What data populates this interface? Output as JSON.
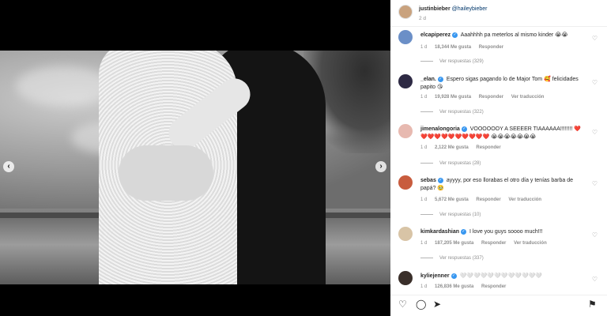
{
  "post": {
    "author": "justinbieber",
    "mention": "@haileybieber",
    "time": "2 d"
  },
  "carousel": {
    "prev_icon": "chevron-left-icon",
    "next_icon": "chevron-right-icon",
    "prev_glyph": "‹",
    "next_glyph": "›",
    "dots_count": 7,
    "active_dot": 5
  },
  "comments": [
    {
      "user": "elcapiperez",
      "text": "Aaahhhh pa meterlos al mismo kinder 😭😭",
      "time": "1 d",
      "likes": "18,344 Me gusta",
      "reply": "Responder",
      "translate": "",
      "replies": "Ver respuestas (329)",
      "avatar_color": "#6b8fc7"
    },
    {
      "user": "_elan.",
      "text": "Espero sigas pagando lo de Major Tom 🥰 felicidades papito 😘",
      "time": "1 d",
      "likes": "19,928 Me gusta",
      "reply": "Responder",
      "translate": "Ver traducción",
      "replies": "Ver respuestas (322)",
      "avatar_color": "#2e2a44"
    },
    {
      "user": "jimenalongoria",
      "text": "VOOOOOOY A SEEEER TIAAAAAA!!!!!!!! ❤️ ❤️❤️❤️❤️❤️❤️❤️❤️❤️❤️ 😭😭😭😭😭😭😭",
      "time": "1 d",
      "likes": "2,122 Me gusta",
      "reply": "Responder",
      "translate": "",
      "replies": "Ver respuestas (28)",
      "avatar_color": "#e7b9b0"
    },
    {
      "user": "sebas",
      "text": "ayyyy, por eso llorabas el otro día y tenías barba de papá? 🥹",
      "time": "1 d",
      "likes": "5,672 Me gusta",
      "reply": "Responder",
      "translate": "Ver traducción",
      "replies": "Ver respuestas (10)",
      "avatar_color": "#c85c3e"
    },
    {
      "user": "kimkardashian",
      "text": "I love you guys soooo much!!!",
      "time": "1 d",
      "likes": "187,205 Me gusta",
      "reply": "Responder",
      "translate": "Ver traducción",
      "replies": "Ver respuestas (337)",
      "avatar_color": "#d8c4a6"
    },
    {
      "user": "kyliejenner",
      "text": "🤍🤍🤍🤍🤍🤍🤍🤍🤍🤍🤍🤍",
      "time": "1 d",
      "likes": "126,836 Me gusta",
      "reply": "Responder",
      "translate": "",
      "replies": "",
      "avatar_color": "#3a2f2a"
    }
  ],
  "actions": {
    "like_icon": "heart-icon",
    "comment_icon": "comment-icon",
    "share_icon": "share-icon",
    "save_icon": "bookmark-icon",
    "like_glyph": "♡",
    "comment_glyph": "◯",
    "share_glyph": "➤",
    "save_glyph": "⚑"
  },
  "colors": {
    "verified": "#3897f0",
    "mention": "#00376b",
    "meta": "#8e8e8e"
  }
}
